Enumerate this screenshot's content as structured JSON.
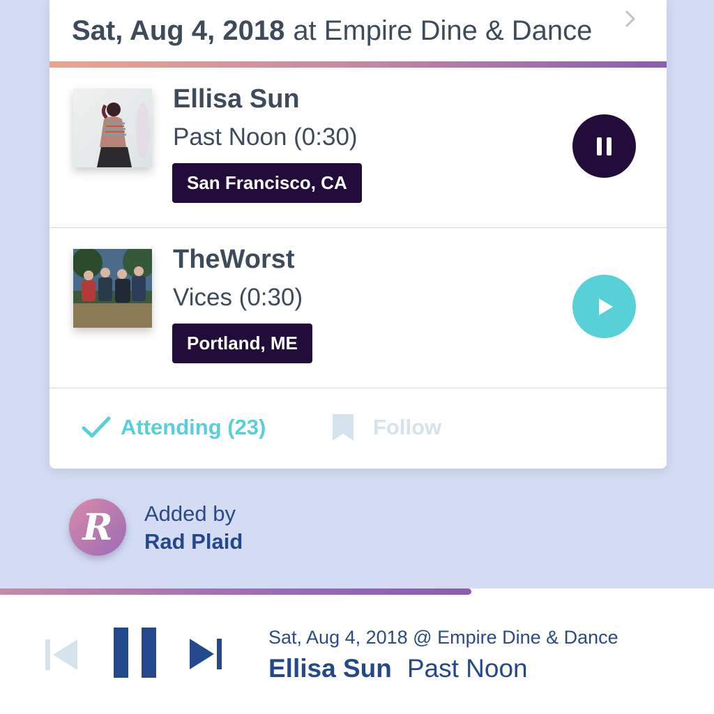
{
  "event": {
    "date": "Sat, Aug 4, 2018",
    "venue_text": "at Empire Dine & Dance"
  },
  "artists": [
    {
      "name": "Ellisa Sun",
      "track": "Past Noon (0:30)",
      "location": "San Francisco, CA",
      "state": "playing"
    },
    {
      "name": "TheWorst",
      "track": "Vices (0:30)",
      "location": "Portland, ME",
      "state": "paused"
    }
  ],
  "actions": {
    "attending_label": "Attending (23)",
    "follow_label": "Follow"
  },
  "added_by": {
    "label": "Added by",
    "name": "Rad Plaid",
    "avatar_letter": "R"
  },
  "player": {
    "meta": "Sat, Aug 4, 2018 @ Empire Dine & Dance",
    "artist": "Ellisa Sun",
    "track": "Past Noon",
    "progress": 0.66
  },
  "colors": {
    "background": "#d3dcf3",
    "badge": "#220d3a",
    "teal": "#58d0d8",
    "navy": "#24488c",
    "text": "#3e4b5b"
  },
  "icons": {
    "header_chevron": "chevron-right-icon",
    "pause": "pause-icon",
    "play": "play-icon",
    "check": "check-icon",
    "bookmark": "bookmark-icon",
    "previous": "skip-previous-icon",
    "next": "skip-next-icon"
  }
}
